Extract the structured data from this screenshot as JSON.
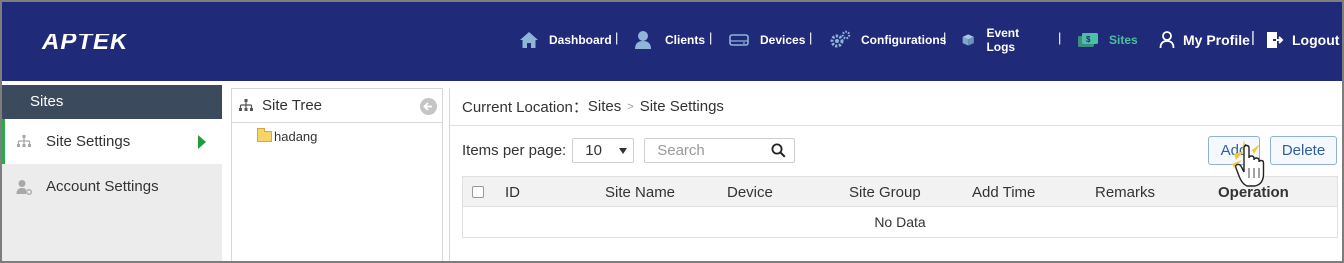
{
  "brand": {
    "logo_text": "APTEK"
  },
  "nav": {
    "items": [
      {
        "label": "Dashboard",
        "icon": "home-icon"
      },
      {
        "label": "Clients",
        "icon": "person-icon"
      },
      {
        "label": "Devices",
        "icon": "device-icon"
      },
      {
        "label": "Configurations",
        "icon": "gears-icon"
      },
      {
        "label": "Event Logs",
        "icon": "box-icon"
      },
      {
        "label": "Sites",
        "icon": "sites-icon",
        "active": true
      }
    ],
    "separator": "|",
    "my_profile": "My Profile",
    "logout": "Logout"
  },
  "sidebar": {
    "title": "Sites",
    "items": [
      {
        "label": "Site Settings",
        "icon": "tree-icon",
        "active": true
      },
      {
        "label": "Account Settings",
        "icon": "user-settings-icon"
      }
    ]
  },
  "tree": {
    "title": "Site Tree",
    "nodes": [
      {
        "label": "hadang",
        "icon": "folder-icon"
      }
    ]
  },
  "breadcrumb": {
    "prefix": "Current Location：",
    "items": [
      "Sites",
      "Site Settings"
    ],
    "separator": ">"
  },
  "toolbar": {
    "items_per_page_label": "Items per page:",
    "items_per_page_value": "10",
    "search_placeholder": "Search",
    "add_label": "Add",
    "delete_label": "Delete"
  },
  "table": {
    "columns": [
      "ID",
      "Site Name",
      "Device",
      "Site Group",
      "Add Time",
      "Remarks",
      "Operation"
    ],
    "empty_text": "No Data"
  },
  "colors": {
    "header_bg": "#1f2a78",
    "active_nav": "#4bc0a3",
    "sidebar_title_bg": "#3b4a5c",
    "active_marker": "#2aa84a"
  }
}
